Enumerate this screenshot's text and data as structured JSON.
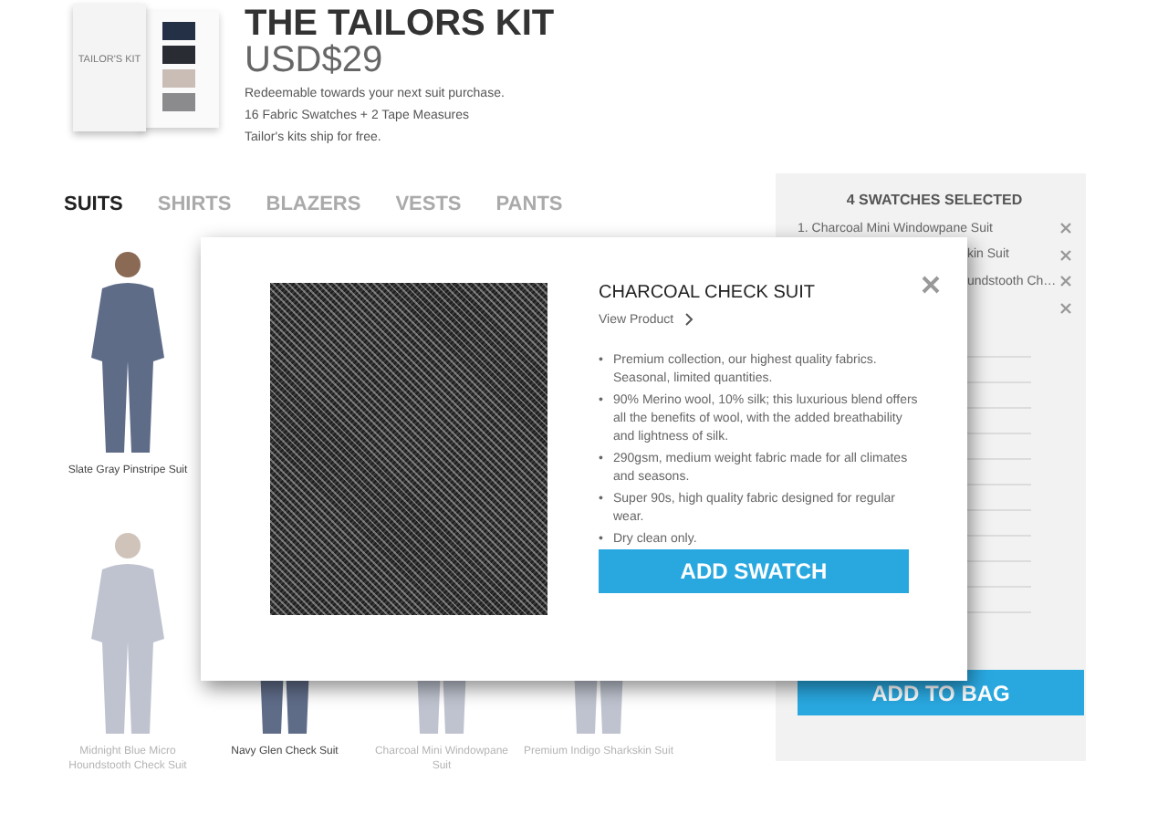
{
  "kit": {
    "label": "TAILOR'S KIT",
    "swatches": [
      {
        "color": "#243045"
      },
      {
        "color": "#2a2c33"
      },
      {
        "color": "#c9bdb6"
      },
      {
        "color": "#8b8b8e"
      }
    ]
  },
  "header": {
    "title": "THE TAILORS KIT",
    "price": "USD$29",
    "lines": [
      "Redeemable towards your next suit purchase.",
      "16 Fabric Swatches + 2 Tape Measures",
      "Tailor's kits ship for free."
    ]
  },
  "tabs": [
    {
      "label": "SUITS",
      "selected": true
    },
    {
      "label": "SHIRTS",
      "selected": false
    },
    {
      "label": "BLAZERS",
      "selected": false
    },
    {
      "label": "VESTS",
      "selected": false
    },
    {
      "label": "PANTS",
      "selected": false
    }
  ],
  "product_rows": [
    [
      {
        "name": "Slate Gray Pinstripe Suit",
        "selected": false
      }
    ],
    [
      {
        "name": "Midnight Blue Micro Houndstooth Check Suit",
        "selected": true
      },
      {
        "name": "Navy Glen Check Suit",
        "selected": false
      },
      {
        "name": "Charcoal Mini Windowpane Suit",
        "selected": true
      },
      {
        "name": "Premium Indigo Sharkskin Suit",
        "selected": true
      }
    ]
  ],
  "sidebar": {
    "title": "4 SWATCHES SELECTED",
    "items": [
      {
        "kind": "full",
        "text": "1. Charcoal Mini Windowpane Suit"
      },
      {
        "kind": "partial",
        "text": "kin Suit"
      },
      {
        "kind": "partial",
        "text": "undstooth Ch…"
      },
      {
        "kind": "empty"
      }
    ],
    "button": "ADD TO BAG"
  },
  "modal": {
    "marker": "•",
    "title": "CHARCOAL CHECK SUIT",
    "link": "View Product",
    "bullets": [
      "Premium collection, our highest quality fabrics. Seasonal, limited quantities.",
      "90% Merino wool, 10% silk; this luxurious blend offers all the benefits of wool, with the added breathability and lightness of silk.",
      "290gsm, medium weight fabric made for all climates and seasons.",
      "Super 90s, high quality fabric designed for regular wear.",
      "Dry clean only."
    ],
    "button": "ADD SWATCH"
  }
}
